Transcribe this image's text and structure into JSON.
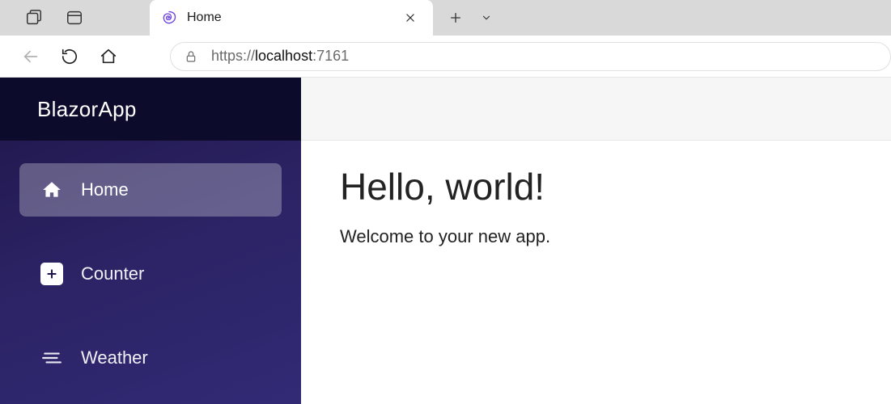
{
  "browser": {
    "tab": {
      "title": "Home"
    },
    "url": {
      "scheme": "https://",
      "host": "localhost",
      "port": ":7161"
    }
  },
  "sidebar": {
    "brand": "BlazorApp",
    "items": [
      {
        "label": "Home"
      },
      {
        "label": "Counter"
      },
      {
        "label": "Weather"
      }
    ]
  },
  "content": {
    "heading": "Hello, world!",
    "subtext": "Welcome to your new app."
  }
}
